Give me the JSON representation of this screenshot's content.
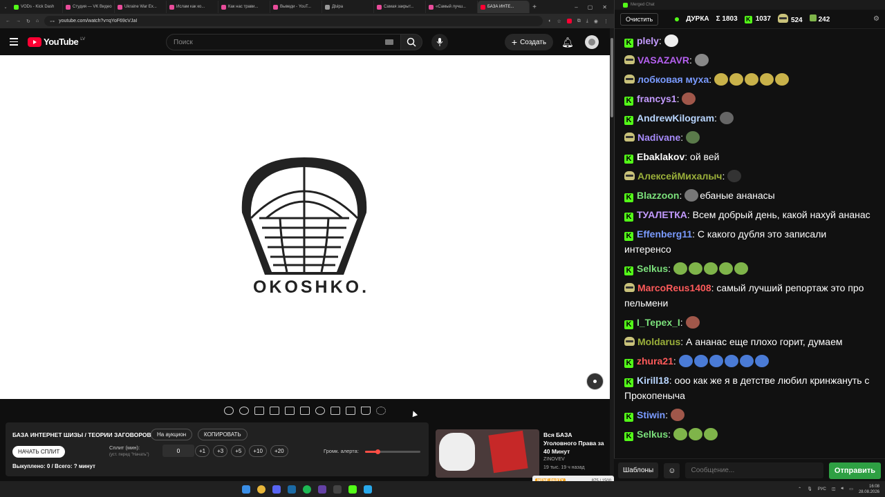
{
  "browser": {
    "tabs": [
      {
        "label": "VODs - Kick Dash",
        "color": "#53fc18"
      },
      {
        "label": "Студия — VK Видео",
        "color": "#e84c9a"
      },
      {
        "label": "Ukraine War Ex...",
        "color": "#e84c9a"
      },
      {
        "label": "Ислам как ко...",
        "color": "#e84c9a"
      },
      {
        "label": "Как нас трави...",
        "color": "#e84c9a"
      },
      {
        "label": "Выведи - YouT...",
        "color": "#e84c9a"
      },
      {
        "label": "ДЫра",
        "color": "#999"
      },
      {
        "label": "Самая закрыт...",
        "color": "#e84c9a"
      },
      {
        "label": "«Самый лучш...",
        "color": "#e84c9a"
      },
      {
        "label": "БАЗА ИНТЕ...",
        "color": "#ff0033",
        "active": true
      }
    ],
    "url": "youtube.com/watch?v=qYoF69cVJaI"
  },
  "youtube": {
    "logo_text": "YouTube",
    "region": "LV",
    "search_placeholder": "Поиск",
    "create_label": "Создать",
    "video_brand": "OKOSHKO."
  },
  "panel": {
    "title": "БАЗА ИНТЕРНЕТ ШИЗЫ / ТЕОРИИ ЗАГОВОРОВ",
    "auction_label": "На аукцион",
    "copy_label": "КОПИРОВАТЬ",
    "start_label": "НАЧАТЬ СПЛИТ",
    "split_label": "Сплит (мин):",
    "split_hint": "(уст. перед \"Начать\")",
    "split_value": "0",
    "increments": [
      "+1",
      "+3",
      "+5",
      "+10",
      "+20"
    ],
    "volume_label": "Громк. алерта:",
    "volume_level": 0.22,
    "bought_text": "Выкуплено: 0 / Всего: ? минут"
  },
  "recommended": {
    "title": "Вся БАЗА Уголовного Права за 40 Минут",
    "channel": "ZINOVEV",
    "meta": "19 тыс.  19 ч назад",
    "badge": "NENE PARTY",
    "progress": "875 / 1500"
  },
  "chat": {
    "window_title": "Merged Chat",
    "clear_label": "Очистить",
    "streamer": "ДУРКА",
    "stats": {
      "total": "Σ 1803",
      "kick": "1037",
      "twitch": "524",
      "other": "242"
    },
    "messages": [
      {
        "platform": "kick",
        "user": "plely",
        "color": "#c49bff",
        "text": "",
        "emotes": 1,
        "emote_color": "#eee"
      },
      {
        "platform": "twitch",
        "user": "VASAZAVR",
        "color": "#b560f0",
        "text": "",
        "emotes": 1,
        "emote_color": "#888"
      },
      {
        "platform": "twitch",
        "user": "лобковая муха",
        "color": "#7a9bff",
        "text": "",
        "emotes": 5,
        "emote_color": "#c9b24a"
      },
      {
        "platform": "kick",
        "user": "francys1",
        "color": "#c49bff",
        "text": "",
        "emotes": 1,
        "emote_color": "#a0574a"
      },
      {
        "platform": "kick",
        "user": "AndrewKilogram",
        "color": "#b9d6ff",
        "text": "",
        "emotes": 1,
        "emote_color": "#666"
      },
      {
        "platform": "twitch",
        "user": "Nadivane",
        "color": "#a78bfa",
        "text": "",
        "emotes": 1,
        "emote_color": "#5a7a4a"
      },
      {
        "platform": "kick",
        "user": "Ebaklakov",
        "color": "#ffffff",
        "text": "ой вей",
        "emotes": 0,
        "emote_color": ""
      },
      {
        "platform": "twitch",
        "user": "АлексейМихалыч",
        "color": "#9bb03a",
        "text": "",
        "emotes": 1,
        "emote_color": "#333"
      },
      {
        "platform": "kick",
        "user": "Blazzoon",
        "color": "#7be07b",
        "text": "ебаные ананасы",
        "emotes": 1,
        "emote_color": "#777"
      },
      {
        "platform": "kick",
        "user": "ТУАЛЕТКА",
        "color": "#c49bff",
        "text": "Всем добрый день, какой нахуй ананас",
        "emotes": 0,
        "emote_color": ""
      },
      {
        "platform": "kick",
        "user": "Effenberg11",
        "color": "#7a9bff",
        "text": "С какого дубля это записали интеренсо",
        "emotes": 0,
        "emote_color": ""
      },
      {
        "platform": "kick",
        "user": "Selkus",
        "color": "#7be07b",
        "text": "",
        "emotes": 5,
        "emote_color": "#7fb44a"
      },
      {
        "platform": "twitch",
        "user": "MarcoReus1408",
        "color": "#ff5a5a",
        "text": "самый лучший репортаж это про пельмени",
        "emotes": 0,
        "emote_color": ""
      },
      {
        "platform": "kick",
        "user": "I_Tepex_I",
        "color": "#7be07b",
        "text": "",
        "emotes": 1,
        "emote_color": "#a0574a"
      },
      {
        "platform": "twitch",
        "user": "Moldarus",
        "color": "#9bb03a",
        "text": "А ананас еще плохо горит, думаем",
        "emotes": 0,
        "emote_color": ""
      },
      {
        "platform": "kick",
        "user": "zhura21",
        "color": "#ff5a5a",
        "text": "",
        "emotes": 6,
        "emote_color": "#4a7bd6"
      },
      {
        "platform": "kick",
        "user": "Kirill18",
        "color": "#b9d6ff",
        "text": "ооо как же я в детстве любил кринжануть с Прокопеныча",
        "emotes": 0,
        "emote_color": ""
      },
      {
        "platform": "kick",
        "user": "Stiwin",
        "color": "#7a9bff",
        "text": "",
        "emotes": 1,
        "emote_color": "#a0574a"
      },
      {
        "platform": "kick",
        "user": "Selkus",
        "color": "#7be07b",
        "text": "",
        "emotes": 3,
        "emote_color": "#7fb44a"
      }
    ],
    "templates_label": "Шаблоны",
    "input_placeholder": "Сообщение...",
    "send_label": "Отправить"
  },
  "system": {
    "lang": "РУС",
    "time": "16:08",
    "date": "28.08.2026"
  }
}
